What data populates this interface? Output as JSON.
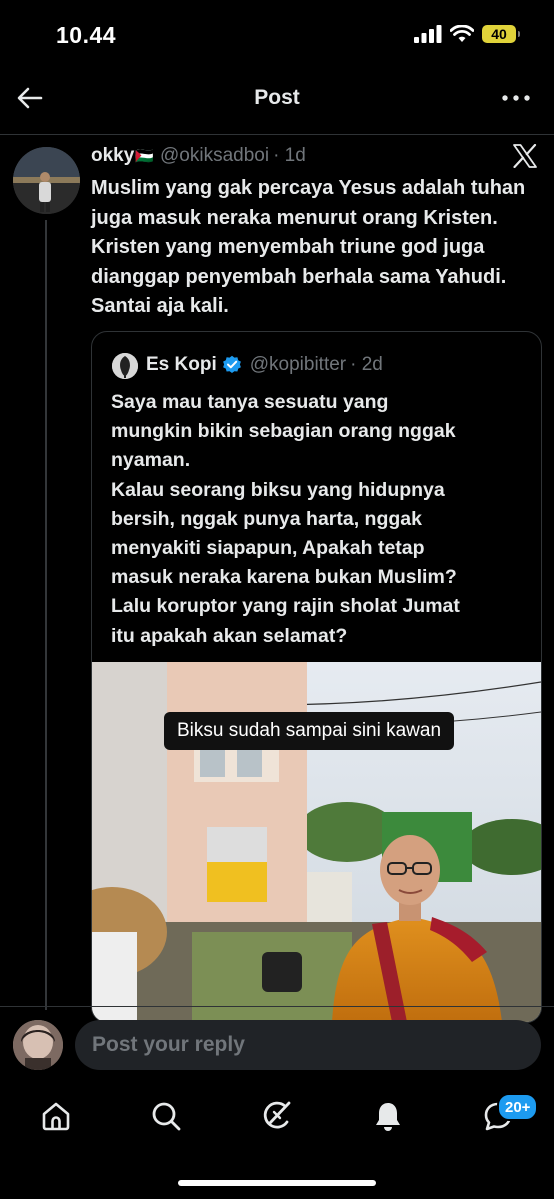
{
  "status_bar": {
    "time": "10.44",
    "battery": "40"
  },
  "header": {
    "title": "Post",
    "back_icon": "arrow-left-icon",
    "more_icon": "more-horizontal-icon"
  },
  "post": {
    "name": "okky",
    "flag": "🇵🇸",
    "handle": "@okiksadboi",
    "time": "· 1d",
    "text": "Muslim yang gak percaya Yesus adalah tuhan juga masuk neraka menurut orang Kristen. Kristen yang menyembah triune god juga dianggap penyembah berhala sama Yahudi. Santai aja kali.",
    "platform_icon": "x-logo-icon"
  },
  "quote": {
    "name": "Es Kopi",
    "handle": "@kopibitter",
    "time": "· 2d",
    "verified_icon": "verified-badge-icon",
    "text_lines": [
      "Saya mau tanya sesuatu yang",
      "mungkin bikin sebagian orang nggak",
      "nyaman.",
      "Kalau seorang biksu yang hidupnya",
      "bersih, nggak punya harta, nggak",
      "menyakiti siapapun, Apakah tetap",
      "masuk neraka karena bukan Muslim?",
      "Lalu koruptor yang rajin sholat Jumat",
      "itu apakah akan selamat?"
    ],
    "media_caption": "Biksu sudah sampai sini kawan"
  },
  "reply": {
    "placeholder": "Post your reply"
  },
  "nav": {
    "items": [
      "home-icon",
      "search-icon",
      "grok-icon",
      "notifications-icon",
      "messages-icon"
    ],
    "messages_badge": "20+"
  },
  "colors": {
    "background": "#000000",
    "text": "#e7e9ea",
    "muted": "#71767b",
    "accent": "#1d9bf0",
    "border": "#2f3336"
  }
}
